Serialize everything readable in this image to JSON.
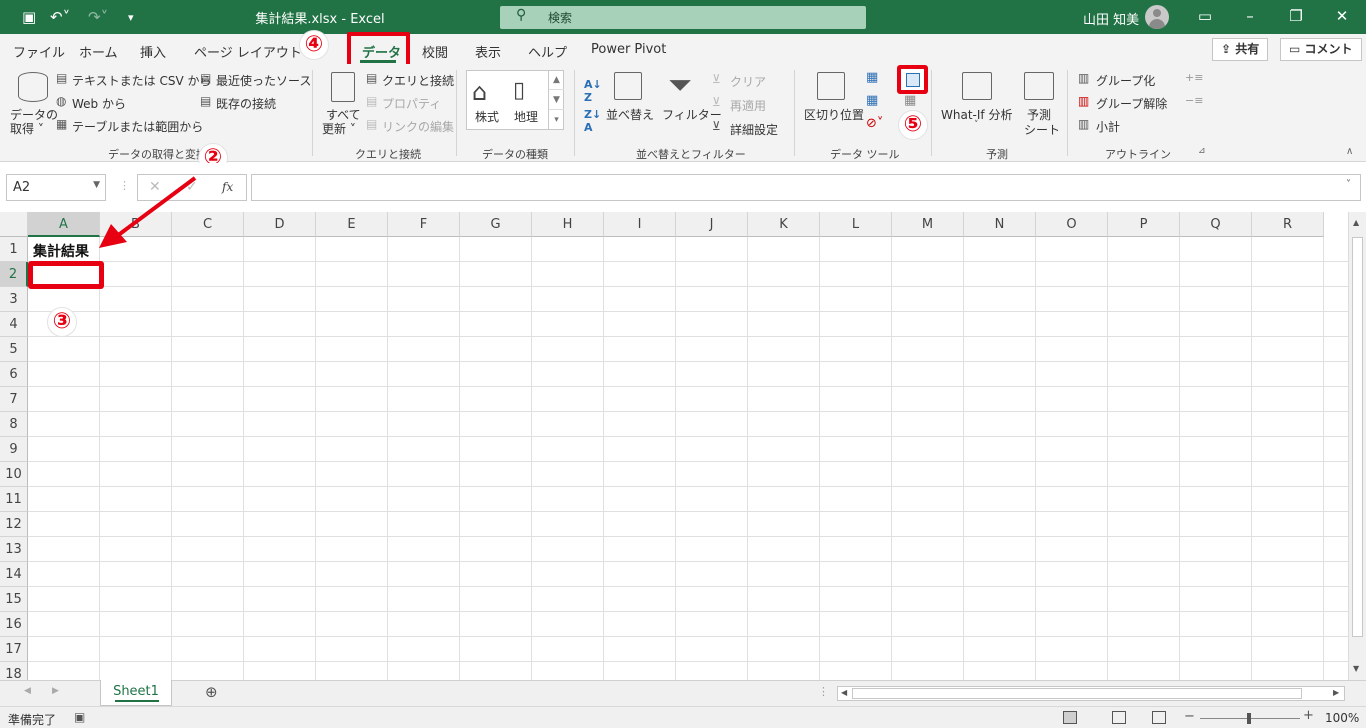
{
  "titlebar": {
    "filename": "集計結果.xlsx",
    "separator": " - ",
    "app": "Excel",
    "search_placeholder": "検索",
    "user": "山田 知美"
  },
  "tabs": [
    "ファイル",
    "ホーム",
    "挿入",
    "ページ レイアウト",
    "データ",
    "校閲",
    "表示",
    "ヘルプ",
    "Power Pivot"
  ],
  "active_tab": "データ",
  "share_label": "共有",
  "comment_label": "コメント",
  "ribbon": {
    "get_data": {
      "label1": "データの",
      "label2": "取得 ˅",
      "items": [
        "テキストまたは CSV から",
        "Web から",
        "テーブルまたは範囲から",
        "最近使ったソース",
        "既存の接続"
      ],
      "group": "データの取得と変換"
    },
    "queries": {
      "refresh1": "すべて",
      "refresh2": "更新 ˅",
      "items": [
        "クエリと接続",
        "プロパティ",
        "リンクの編集"
      ],
      "group": "クエリと接続"
    },
    "datatypes": {
      "stocks": "株式",
      "geo": "地理",
      "group": "データの種類"
    },
    "sortfilter": {
      "sort": "並べ替え",
      "filter": "フィルター",
      "clear": "クリア",
      "reapply": "再適用",
      "advanced": "詳細設定",
      "group": "並べ替えとフィルター"
    },
    "datatools": {
      "split": "区切り位置",
      "group": "データ ツール"
    },
    "forecast": {
      "whatif": "What-If 分析",
      "forecast1": "予測",
      "forecast2": "シート",
      "group": "予測"
    },
    "outline": {
      "items": [
        "グループ化",
        "グループ解除",
        "小計"
      ],
      "group": "アウトライン"
    }
  },
  "formula_bar": {
    "namebox": "A2",
    "fx": "fx",
    "value": ""
  },
  "columns": [
    "A",
    "B",
    "C",
    "D",
    "E",
    "F",
    "G",
    "H",
    "I",
    "J",
    "K",
    "L",
    "M",
    "N",
    "O",
    "P",
    "Q",
    "R"
  ],
  "rows": [
    "1",
    "2",
    "3",
    "4",
    "5",
    "6",
    "7",
    "8",
    "9",
    "10",
    "11",
    "12",
    "13",
    "14",
    "15",
    "16",
    "17",
    "18"
  ],
  "cells": {
    "A1": "集計結果"
  },
  "sheet_tab": "Sheet1",
  "status": {
    "text": "準備完了",
    "zoom": "100%"
  },
  "annotations": [
    "②",
    "③",
    "④",
    "⑤"
  ],
  "colors": {
    "excel_green": "#217346",
    "highlight_red": "#e60012"
  }
}
